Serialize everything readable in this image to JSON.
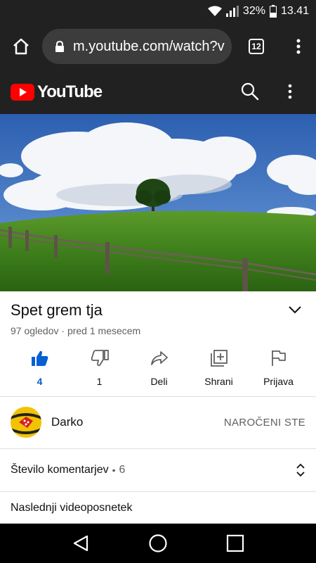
{
  "status_bar": {
    "battery_percent": "32%",
    "time": "13.41"
  },
  "browser": {
    "url": "m.youtube.com/watch?v",
    "tab_count": "12"
  },
  "youtube": {
    "logo_text": "YouTube"
  },
  "video": {
    "title": "Spet grem tja",
    "meta": "97 ogledov · pred 1 mesecem"
  },
  "actions": {
    "like": "4",
    "dislike": "1",
    "share": "Deli",
    "save": "Shrani",
    "report": "Prijava"
  },
  "channel": {
    "name": "Darko",
    "subscribe_state": "NAROČENI STE"
  },
  "comments": {
    "label": "Število komentarjev",
    "count": "6"
  },
  "up_next": {
    "label": "Naslednji videoposnetek"
  },
  "colors": {
    "accent_blue": "#065fd4",
    "youtube_red": "#ff0000",
    "chrome_dark": "#212121"
  }
}
